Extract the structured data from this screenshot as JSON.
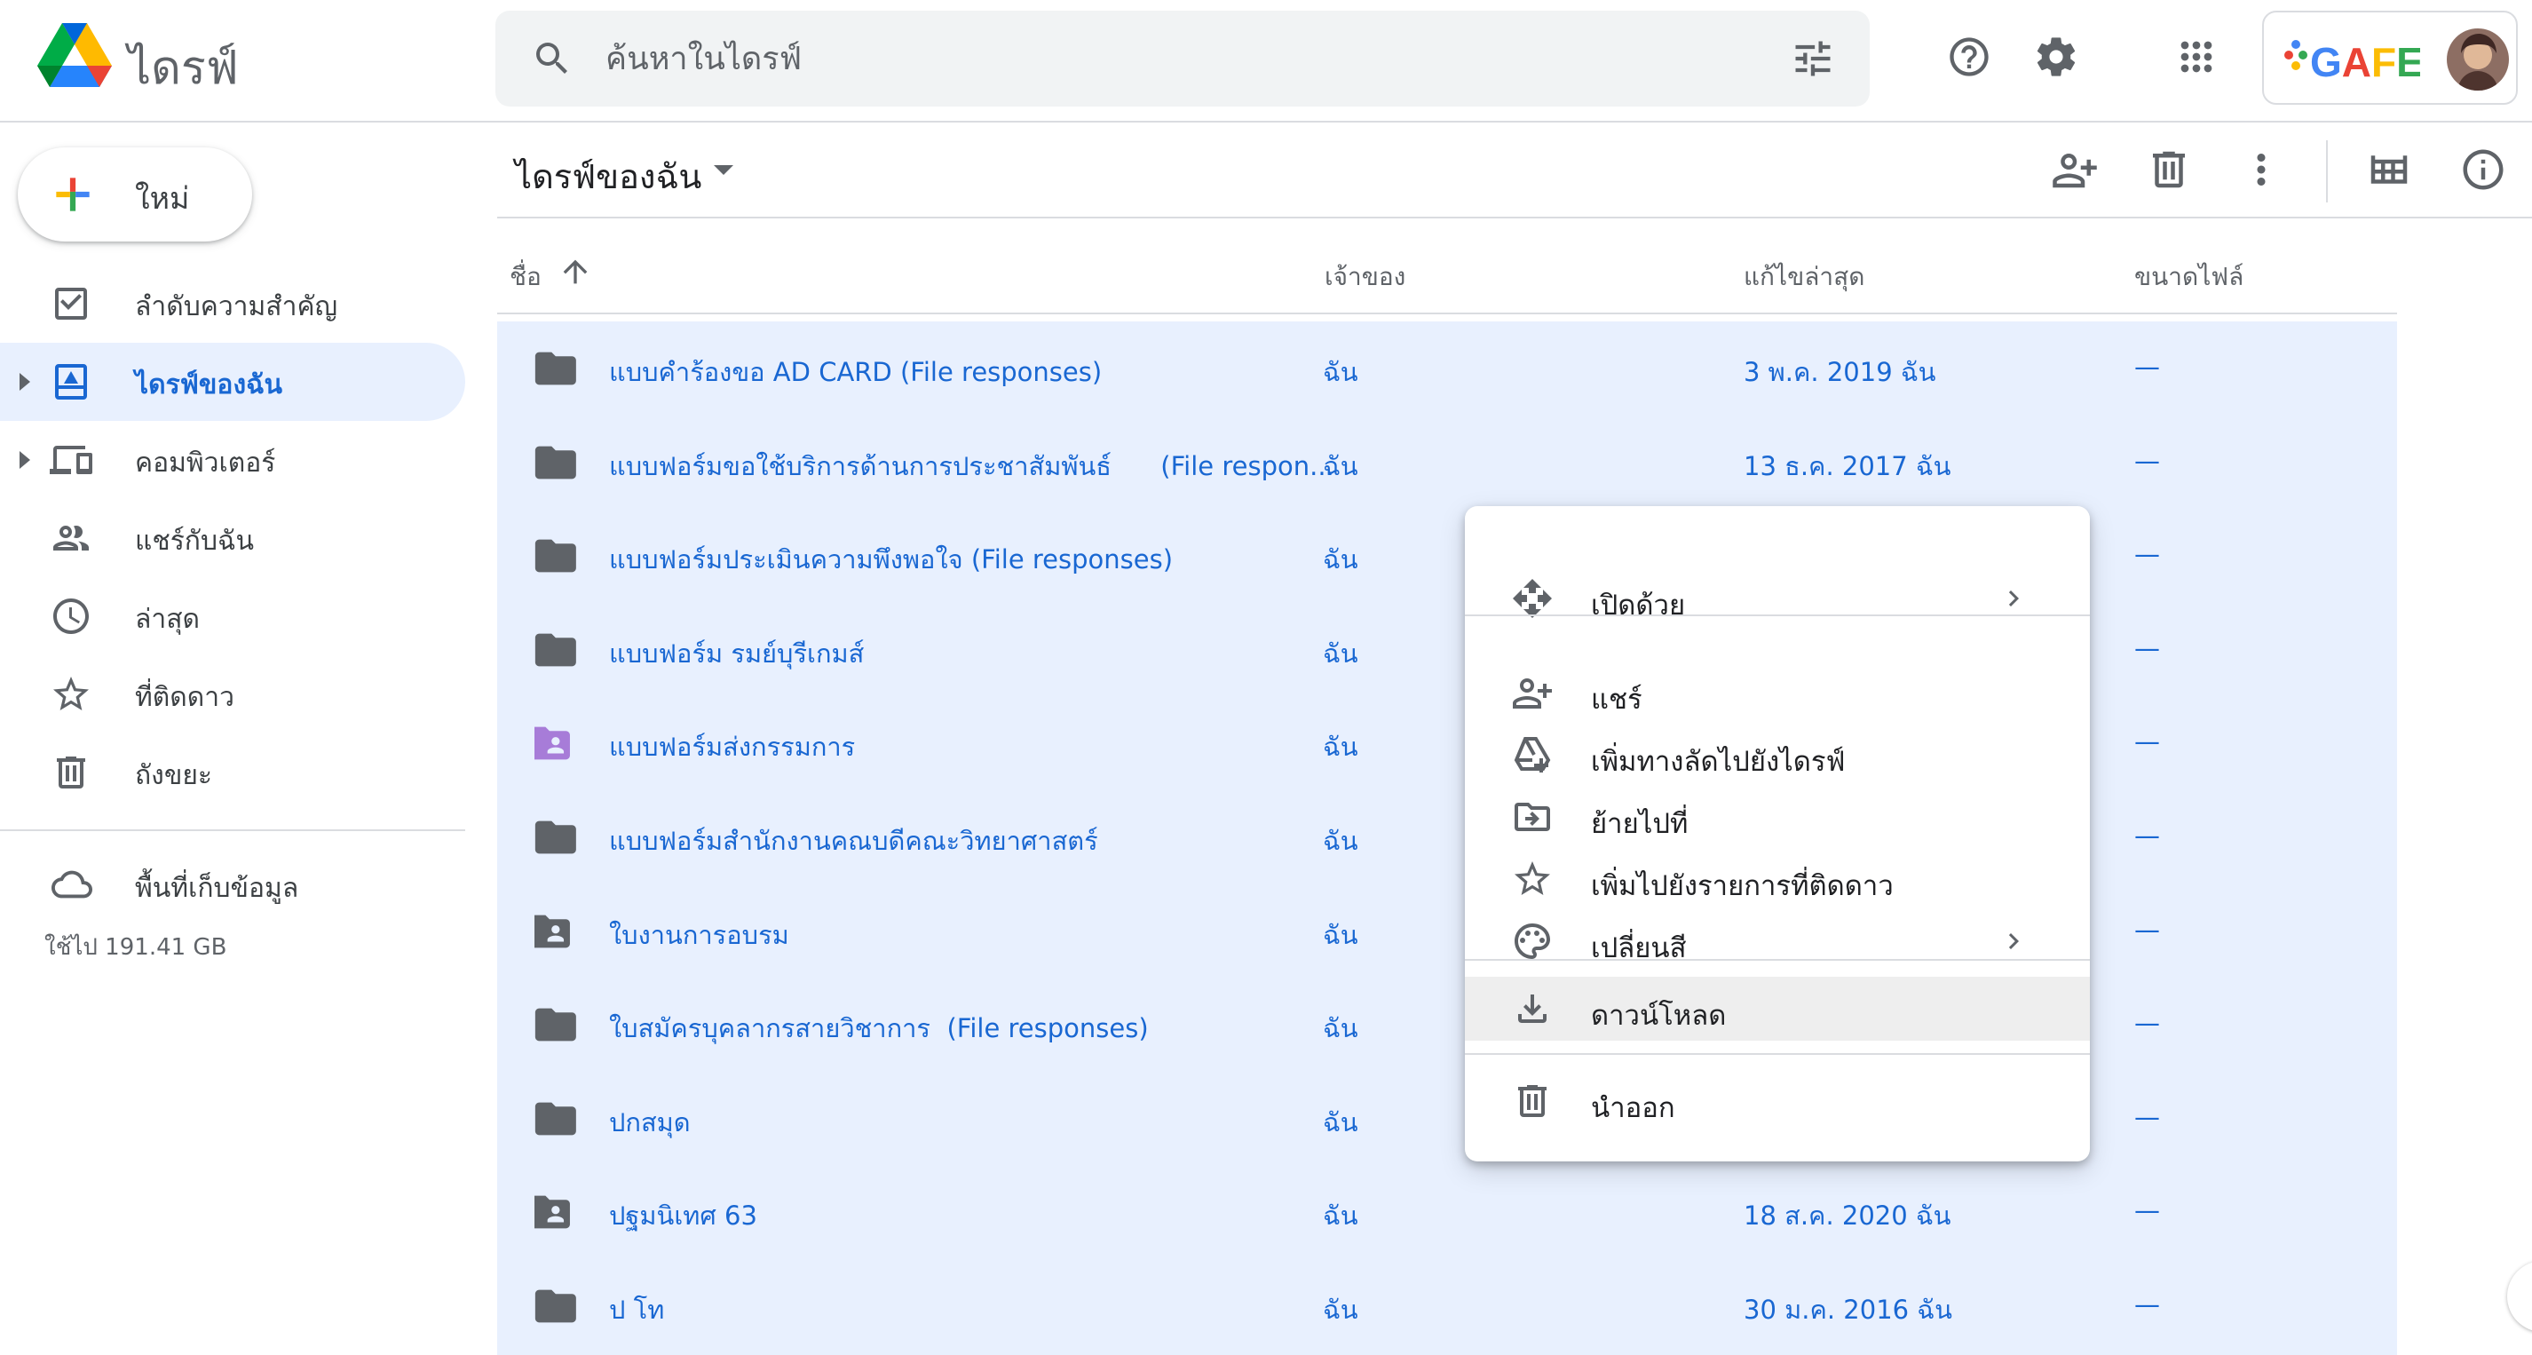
{
  "header": {
    "app_title": "ไดรฟ์",
    "search_placeholder": "ค้นหาในไดรฟ์",
    "account_logo_text": "GAFE"
  },
  "sidebar": {
    "new_label": "ใหม่",
    "items": [
      {
        "label": "ลำดับความสำคัญ",
        "icon": "priority-check-icon"
      },
      {
        "label": "ไดรฟ์ของฉัน",
        "icon": "my-drive-icon",
        "active": true
      },
      {
        "label": "คอมพิวเตอร์",
        "icon": "computers-icon"
      },
      {
        "label": "แชร์กับฉัน",
        "icon": "shared-people-icon"
      },
      {
        "label": "ล่าสุด",
        "icon": "clock-icon"
      },
      {
        "label": "ที่ติดดาว",
        "icon": "star-icon"
      },
      {
        "label": "ถังขยะ",
        "icon": "trash-icon"
      }
    ],
    "storage_label": "พื้นที่เก็บข้อมูล",
    "storage_used": "ใช้ไป 191.41 GB"
  },
  "main": {
    "breadcrumb": "ไดรฟ์ของฉัน",
    "columns": {
      "name": "ชื่อ",
      "owner": "เจ้าของ",
      "modified": "แก้ไขล่าสุด",
      "size": "ขนาดไฟล์"
    },
    "rows": [
      {
        "name": "แบบคำร้องขอ AD CARD (File responses)",
        "owner": "ฉัน",
        "modified": "3 พ.ค. 2019 ฉัน",
        "size": "—",
        "icon": "folder-icon"
      },
      {
        "name": "แบบฟอร์มขอใช้บริการด้านการประชาสัมพันธ์      (File respon...",
        "owner": "ฉัน",
        "modified": "13 ธ.ค. 2017 ฉัน",
        "size": "—",
        "icon": "folder-icon"
      },
      {
        "name": "แบบฟอร์มประเมินความพึงพอใจ (File responses)",
        "owner": "ฉัน",
        "modified": "",
        "size": "—",
        "icon": "folder-icon"
      },
      {
        "name": "แบบฟอร์ม รมย์บุรีเกมส์",
        "owner": "ฉัน",
        "modified": "",
        "size": "—",
        "icon": "folder-icon"
      },
      {
        "name": "แบบฟอร์มส่งกรรมการ",
        "owner": "ฉัน",
        "modified": "",
        "size": "—",
        "icon": "shared-folder-purple-icon"
      },
      {
        "name": "แบบฟอร์มสำนักงานคณบดีคณะวิทยาศาสตร์",
        "owner": "ฉัน",
        "modified": "",
        "size": "—",
        "icon": "folder-icon"
      },
      {
        "name": "ใบงานการอบรม",
        "owner": "ฉัน",
        "modified": "",
        "size": "—",
        "icon": "shared-folder-icon"
      },
      {
        "name": "ใบสมัครบุคลากรสายวิชาการ  (File responses)",
        "owner": "ฉัน",
        "modified": "",
        "size": "—",
        "icon": "folder-icon"
      },
      {
        "name": "ปกสมุด",
        "owner": "ฉัน",
        "modified": "",
        "size": "—",
        "icon": "folder-icon"
      },
      {
        "name": "ปฐมนิเทศ 63",
        "owner": "ฉัน",
        "modified": "18 ส.ค. 2020 ฉัน",
        "size": "—",
        "icon": "shared-folder-icon"
      },
      {
        "name": "ป โท",
        "owner": "ฉัน",
        "modified": "30 ม.ค. 2016 ฉัน",
        "size": "—",
        "icon": "folder-icon"
      }
    ]
  },
  "context_menu": {
    "items": [
      {
        "label": "เปิดด้วย",
        "icon": "open-with-icon",
        "submenu": true
      },
      {
        "label": "แชร์",
        "icon": "share-person-add-icon"
      },
      {
        "label": "เพิ่มทางลัดไปยังไดรฟ์",
        "icon": "add-shortcut-icon"
      },
      {
        "label": "ย้ายไปที่",
        "icon": "move-to-folder-icon"
      },
      {
        "label": "เพิ่มไปยังรายการที่ติดดาว",
        "icon": "star-outline-icon"
      },
      {
        "label": "เปลี่ยนสี",
        "icon": "palette-icon",
        "submenu": true
      },
      {
        "label": "ดาวน์โหลด",
        "icon": "download-icon",
        "highlighted": true
      },
      {
        "label": "นำออก",
        "icon": "trash-icon"
      }
    ]
  },
  "colors": {
    "accent_blue": "#1967d2",
    "selection_bg": "#e8f0fe",
    "folder_gray": "#5f6368",
    "folder_purple": "#a77cd8"
  }
}
